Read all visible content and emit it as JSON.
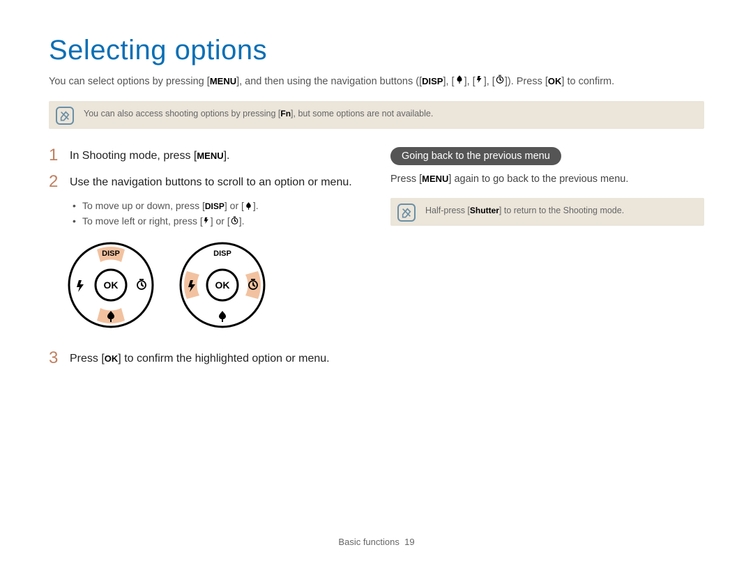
{
  "title": "Selecting options",
  "intro": {
    "part1": "You can select options by pressing [",
    "menu": "MENU",
    "part2": "], and then using the navigation buttons ([",
    "disp": "DISP",
    "part3": "], [",
    "part4": "], [",
    "part5": "], [",
    "part6": "]). Press [",
    "ok": "OK",
    "part7": "] to confirm."
  },
  "note1": {
    "pre": "You can also access shooting options by pressing [",
    "fn": "Fn",
    "post": "], but some options are not available."
  },
  "steps": {
    "s1": {
      "num": "1",
      "pre": "In Shooting mode, press [",
      "menu": "MENU",
      "post": "]."
    },
    "s2": {
      "num": "2",
      "text": "Use the navigation buttons to scroll to an option or menu."
    },
    "s3": {
      "num": "3",
      "pre": "Press [",
      "ok": "OK",
      "post": "] to confirm the highlighted option or menu."
    }
  },
  "bullets": {
    "b1": {
      "pre": "To move up or down, press [",
      "disp": "DISP",
      "mid": "] or [",
      "post": "]."
    },
    "b2": {
      "pre": "To move left or right, press [",
      "mid": "] or [",
      "post": "]."
    }
  },
  "dial": {
    "disp": "DISP",
    "ok": "OK"
  },
  "right": {
    "heading": "Going back to the previous menu",
    "body_pre": "Press [",
    "body_menu": "MENU",
    "body_post": "] again to go back to the previous menu.",
    "note2_pre": "Half-press [",
    "note2_shutter": "Shutter",
    "note2_post": "] to return to the Shooting mode."
  },
  "footer": {
    "section": "Basic functions",
    "page": "19"
  }
}
